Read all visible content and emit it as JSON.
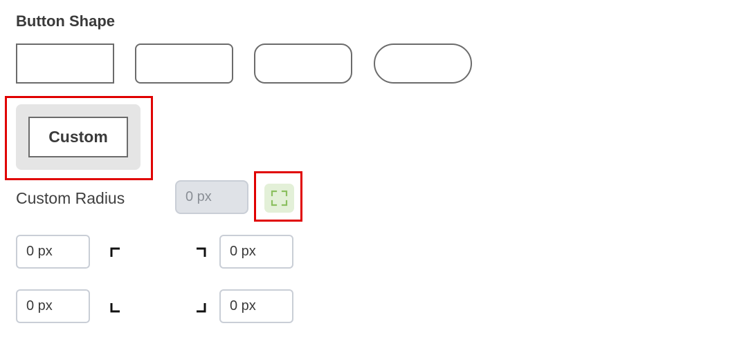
{
  "section": {
    "title": "Button Shape"
  },
  "shapes": [
    {
      "name": "square"
    },
    {
      "name": "slightly-rounded"
    },
    {
      "name": "rounded"
    },
    {
      "name": "pill"
    }
  ],
  "custom": {
    "label": "Custom"
  },
  "custom_radius": {
    "label": "Custom Radius",
    "value": "0 px",
    "expand_icon": "expand-corners-icon",
    "accent": "#8bbf5f"
  },
  "corners": {
    "top_left": "0 px",
    "top_right": "0 px",
    "bottom_left": "0 px",
    "bottom_right": "0 px"
  },
  "colors": {
    "highlight": "#e00000",
    "border": "#6b6b6b"
  }
}
